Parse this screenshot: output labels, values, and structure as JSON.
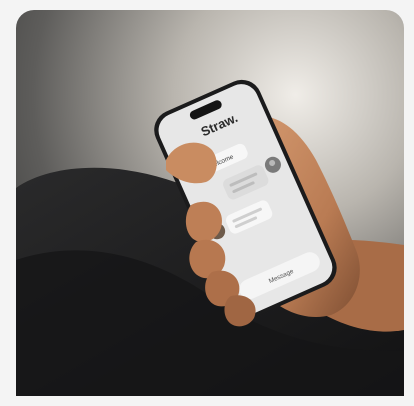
{
  "photo": {
    "subject": "hand holding smartphone displaying chat app",
    "colors": {
      "background_light": "#d9d5cf",
      "background_dark": "#4a4a49",
      "sleeve": "#1c1c1d",
      "skin": "#c7885f",
      "skin_shadow": "#8e5a3b",
      "phone_body": "#202020",
      "screen": "#e6e6e6"
    }
  },
  "app": {
    "brand": "Straw.",
    "welcome": "Welcome",
    "send_label": "Message"
  },
  "icons": {
    "avatar_left_1": "avatar",
    "avatar_right": "avatar",
    "avatar_left_2": "avatar"
  }
}
